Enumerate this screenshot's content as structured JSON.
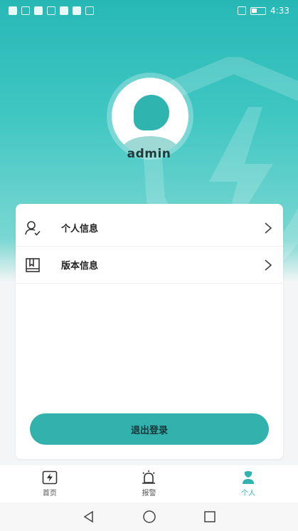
{
  "status_bar": {
    "time": "4:33"
  },
  "profile": {
    "username": "admin"
  },
  "menu": [
    {
      "label": "个人信息",
      "icon": "user-check-icon"
    },
    {
      "label": "版本信息",
      "icon": "book-icon"
    }
  ],
  "logout_label": "退出登录",
  "tabs": [
    {
      "label": "首页",
      "icon": "lightning-icon"
    },
    {
      "label": "报警",
      "icon": "alarm-icon"
    },
    {
      "label": "个人",
      "icon": "person-icon",
      "active": true
    }
  ],
  "colors": {
    "accent": "#2fb4b0",
    "button": "#33b1ad"
  }
}
